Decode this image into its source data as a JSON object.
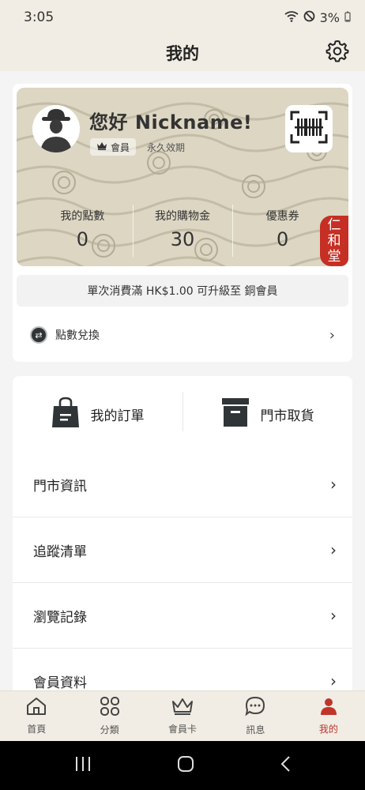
{
  "status": {
    "time": "3:05",
    "battery": "3%"
  },
  "header": {
    "title": "我的"
  },
  "member_card": {
    "greeting": "您好 Nickname!",
    "tier": "會員",
    "validity": "永久效期",
    "stats": [
      {
        "label": "我的點數",
        "value": "0"
      },
      {
        "label": "我的購物金",
        "value": "30"
      },
      {
        "label": "優惠券",
        "value": "0"
      }
    ],
    "seal_chars": [
      "仁",
      "和",
      "堂"
    ]
  },
  "upgrade_text": "單次消費滿 HK$1.00 可升級至 銅會員",
  "points_exchange": "點數兌換",
  "quick_actions": [
    {
      "label": "我的訂單",
      "icon": "shopping-bag-icon"
    },
    {
      "label": "門市取貨",
      "icon": "storage-box-icon"
    }
  ],
  "menu": [
    {
      "label": "門市資訊"
    },
    {
      "label": "追蹤清單"
    },
    {
      "label": "瀏覽記錄"
    },
    {
      "label": "會員資料"
    }
  ],
  "tabs": [
    {
      "label": "首頁",
      "icon": "home-icon"
    },
    {
      "label": "分類",
      "icon": "category-icon"
    },
    {
      "label": "會員卡",
      "icon": "crown-icon"
    },
    {
      "label": "訊息",
      "icon": "chat-icon"
    },
    {
      "label": "我的",
      "icon": "person-icon",
      "active": true
    }
  ],
  "colors": {
    "accent": "#c0352b",
    "header_bg": "#f1ede4",
    "card_bg": "#dcd6c3"
  }
}
